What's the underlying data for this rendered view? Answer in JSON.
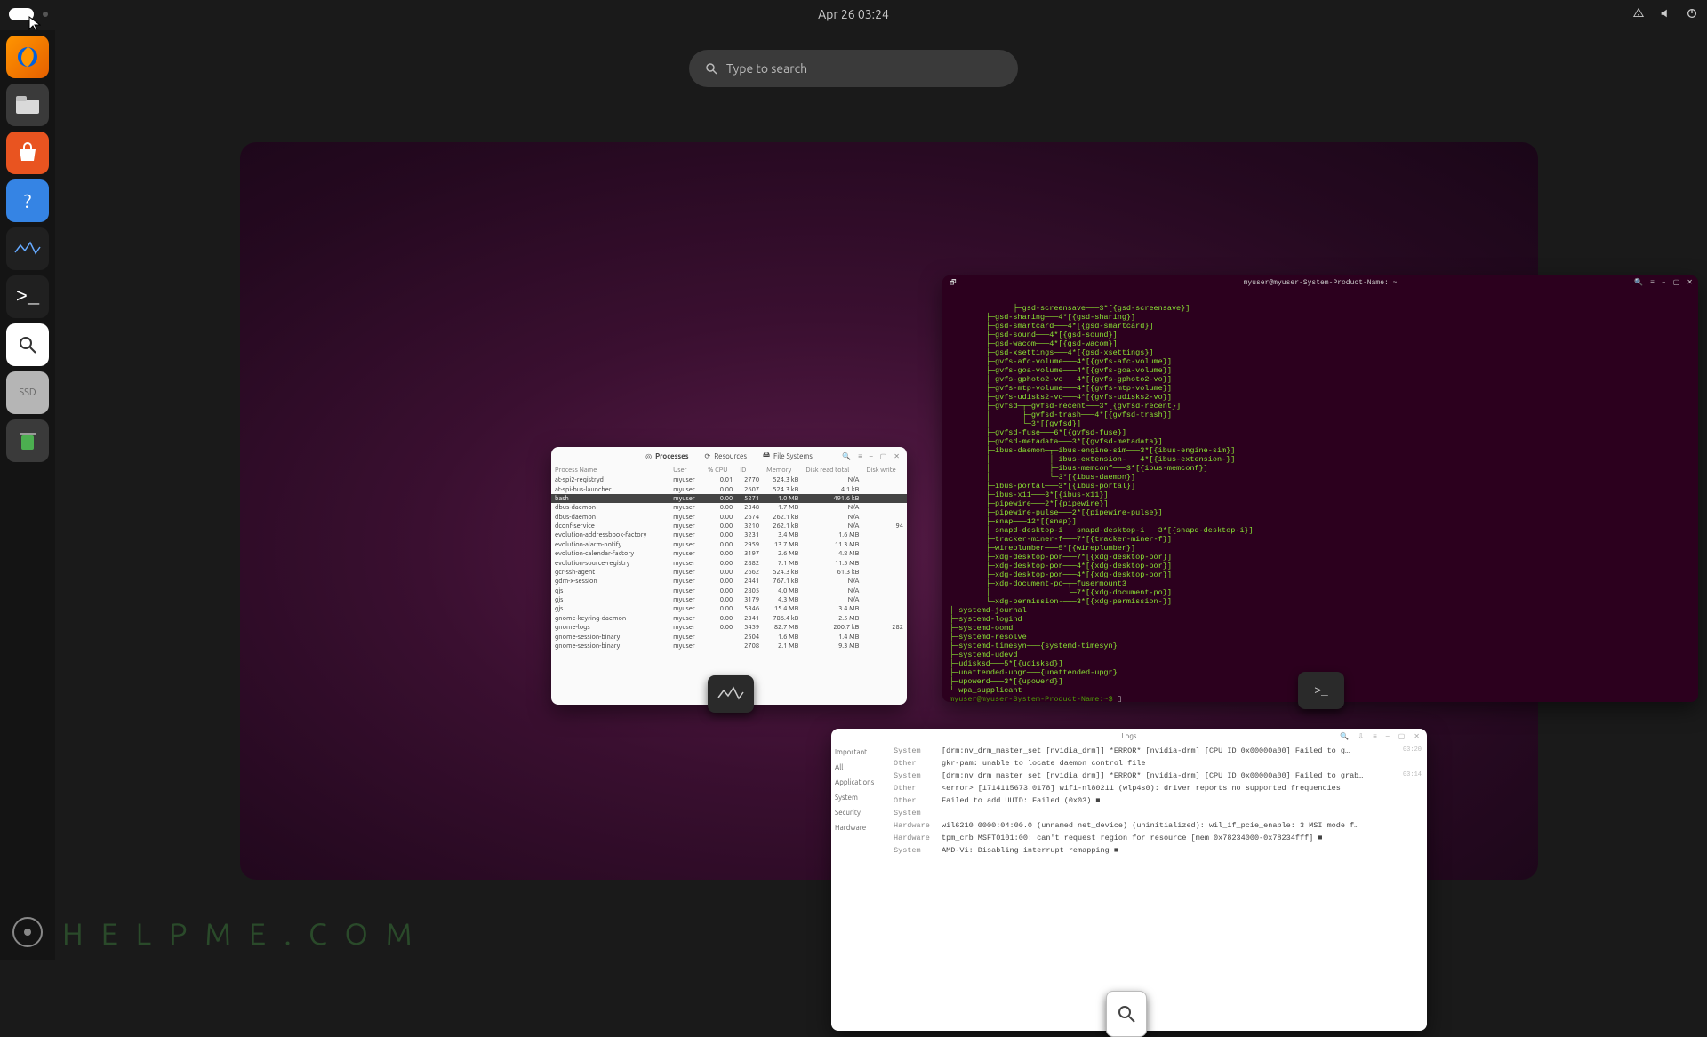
{
  "topbar": {
    "datetime": "Apr 26  03:24"
  },
  "search": {
    "placeholder": "Type to search"
  },
  "dock": {
    "ssd_label": "SSD"
  },
  "sysmon": {
    "tabs": {
      "processes": "Processes",
      "resources": "Resources",
      "filesystems": "File Systems"
    },
    "cols": [
      "Process Name",
      "User",
      "% CPU",
      "ID",
      "Memory",
      "Disk read total",
      "Disk write"
    ],
    "rows": [
      [
        "at-spi2-registryd",
        "myuser",
        "0.01",
        "2770",
        "524.3 kB",
        "N/A",
        ""
      ],
      [
        "at-spi-bus-launcher",
        "myuser",
        "0.00",
        "2607",
        "524.3 kB",
        "4.1 kB",
        ""
      ],
      [
        "bash",
        "myuser",
        "0.00",
        "5271",
        "1.0 MB",
        "491.6 kB",
        ""
      ],
      [
        "dbus-daemon",
        "myuser",
        "0.00",
        "2348",
        "1.7 MB",
        "N/A",
        ""
      ],
      [
        "dbus-daemon",
        "myuser",
        "0.00",
        "2674",
        "262.1 kB",
        "N/A",
        ""
      ],
      [
        "dconf-service",
        "myuser",
        "0.00",
        "3210",
        "262.1 kB",
        "N/A",
        "94"
      ],
      [
        "evolution-addressbook-factory",
        "myuser",
        "0.00",
        "3231",
        "3.4 MB",
        "1.6 MB",
        ""
      ],
      [
        "evolution-alarm-notify",
        "myuser",
        "0.00",
        "2959",
        "13.7 MB",
        "11.3 MB",
        ""
      ],
      [
        "evolution-calendar-factory",
        "myuser",
        "0.00",
        "3197",
        "2.6 MB",
        "4.8 MB",
        ""
      ],
      [
        "evolution-source-registry",
        "myuser",
        "0.00",
        "2882",
        "7.1 MB",
        "11.5 MB",
        ""
      ],
      [
        "gcr-ssh-agent",
        "myuser",
        "0.00",
        "2662",
        "524.3 kB",
        "61.3 kB",
        ""
      ],
      [
        "gdm-x-session",
        "myuser",
        "0.00",
        "2441",
        "767.1 kB",
        "N/A",
        ""
      ],
      [
        "gjs",
        "myuser",
        "0.00",
        "2805",
        "4.0 MB",
        "N/A",
        ""
      ],
      [
        "gjs",
        "myuser",
        "0.00",
        "3179",
        "4.3 MB",
        "N/A",
        ""
      ],
      [
        "gjs",
        "myuser",
        "0.00",
        "5346",
        "15.4 MB",
        "3.4 MB",
        ""
      ],
      [
        "gnome-keyring-daemon",
        "myuser",
        "0.00",
        "2341",
        "786.4 kB",
        "2.5 MB",
        ""
      ],
      [
        "gnome-logs",
        "myuser",
        "0.00",
        "5459",
        "82.7 MB",
        "200.7 kB",
        "282"
      ],
      [
        "gnome-session-binary",
        "myuser",
        "",
        "2504",
        "1.6 MB",
        "1.4 MB",
        ""
      ],
      [
        "gnome-session-binary",
        "myuser",
        "",
        "2708",
        "2.1 MB",
        "9.3 MB",
        ""
      ]
    ],
    "sel_index": 2
  },
  "terminal": {
    "title": "myuser@myuser-System-Product-Name: ~",
    "tree": "        ├─gsd-screensave───3*[{gsd-screensave}]\n        ├─gsd-sharing───4*[{gsd-sharing}]\n        ├─gsd-smartcard───4*[{gsd-smartcard}]\n        ├─gsd-sound───4*[{gsd-sound}]\n        ├─gsd-wacom───4*[{gsd-wacom}]\n        ├─gsd-xsettings───4*[{gsd-xsettings}]\n        ├─gvfs-afc-volume───4*[{gvfs-afc-volume}]\n        ├─gvfs-goa-volume───4*[{gvfs-goa-volume}]\n        ├─gvfs-gphoto2-vo───4*[{gvfs-gphoto2-vo}]\n        ├─gvfs-mtp-volume───4*[{gvfs-mtp-volume}]\n        ├─gvfs-udisks2-vo───4*[{gvfs-udisks2-vo}]\n        ├─gvfsd─┬─gvfsd-recent───3*[{gvfsd-recent}]\n        │       ├─gvfsd-trash───4*[{gvfsd-trash}]\n        │       └─3*[{gvfsd}]\n        ├─gvfsd-fuse───6*[{gvfsd-fuse}]\n        ├─gvfsd-metadata───3*[{gvfsd-metadata}]\n        ├─ibus-daemon─┬─ibus-engine-sim───3*[{ibus-engine-sim}]\n        │             ├─ibus-extension-───4*[{ibus-extension-}]\n        │             ├─ibus-memconf───3*[{ibus-memconf}]\n        │             └─3*[{ibus-daemon}]\n        ├─ibus-portal───3*[{ibus-portal}]\n        ├─ibus-x11───3*[{ibus-x11}]\n        ├─pipewire───2*[{pipewire}]\n        ├─pipewire-pulse───2*[{pipewire-pulse}]\n        ├─snap───12*[{snap}]\n        ├─snapd-desktop-i───snapd-desktop-i───3*[{snapd-desktop-i}]\n        ├─tracker-miner-f───7*[{tracker-miner-f}]\n        ├─wireplumber───5*[{wireplumber}]\n        ├─xdg-desktop-por───7*[{xdg-desktop-por}]\n        ├─xdg-desktop-por───4*[{xdg-desktop-por}]\n        ├─xdg-desktop-por───4*[{xdg-desktop-por}]\n        ├─xdg-document-po─┬─fusermount3\n        │                 └─7*[{xdg-document-po}]\n        └─xdg-permission-───3*[{xdg-permission-}]\n├─systemd-journal\n├─systemd-logind\n├─systemd-oomd\n├─systemd-resolve\n├─systemd-timesyn───{systemd-timesyn}\n├─systemd-udevd\n├─udisksd───5*[{udisksd}]\n├─unattended-upgr───{unattended-upgr}\n├─upowerd───3*[{upowerd}]\n└─wpa_supplicant",
    "prompt": "myuser@myuser-System-Product-Name:~$ "
  },
  "logs": {
    "title": "Logs",
    "side": [
      "Important",
      "All",
      "Applications",
      "System",
      "Security",
      "Hardware"
    ],
    "rows": [
      {
        "tag": "System",
        "msg": "[drm:nv_drm_master_set [nvidia_drm]] *ERROR* [nvidia-drm] [CPU ID 0x00000a00] Failed to g…",
        "ct": "03:20"
      },
      {
        "tag": "Other",
        "msg": "gkr-pam: unable to locate daemon control file",
        "ct": ""
      },
      {
        "tag": "System",
        "msg": "[drm:nv_drm_master_set [nvidia_drm]] *ERROR* [nvidia-drm] [CPU ID 0x00000a00] Failed to grab…",
        "ct": "03:14"
      },
      {
        "tag": "Other",
        "msg": "<error> [1714115673.0178] wifi-nl80211 (wlp4s0): driver reports no supported frequencies",
        "ct": ""
      },
      {
        "tag": "Other",
        "msg": "Failed to add UUID: Failed (0x03) ■",
        "ct": ""
      },
      {
        "tag": "System",
        "msg": "",
        "ct": ""
      },
      {
        "tag": "Hardware",
        "msg": "wil6210 0000:04:00.0 (unnamed net_device) (uninitialized): wil_if_pcie_enable: 3 MSI mode f…",
        "ct": ""
      },
      {
        "tag": "Hardware",
        "msg": "tpm_crb MSFT0101:00: can't request region for resource [mem 0x78234000-0x78234fff] ■",
        "ct": ""
      },
      {
        "tag": "System",
        "msg": "AMD-Vi: Disabling interrupt remapping ■",
        "ct": ""
      }
    ]
  },
  "watermark": "HELPME.COM"
}
